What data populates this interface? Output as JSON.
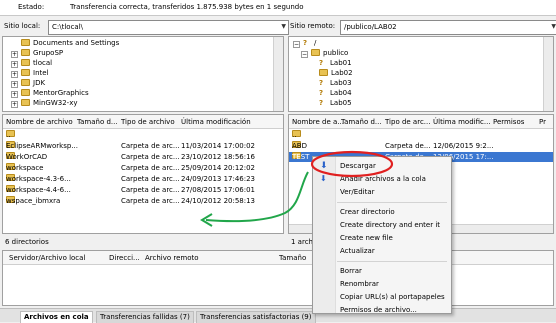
{
  "status": {
    "label": "Estado:",
    "text": "Transferencia correcta, transferidos 1.875.938 bytes en 1 segundo"
  },
  "local": {
    "path_label": "Sitio local:",
    "path": "C:\\tlocal\\",
    "tree": [
      {
        "label": "Documents and Settings"
      },
      {
        "label": "GrupoSP"
      },
      {
        "label": "tlocal"
      },
      {
        "label": "Intel"
      },
      {
        "label": "JDK"
      },
      {
        "label": "MentorGraphics"
      },
      {
        "label": "MinGW32-xy"
      }
    ],
    "columns": [
      "Nombre de archivo",
      "Tamaño d...",
      "Tipo de archivo",
      "Última modificación"
    ],
    "rows": [
      {
        "name": "..",
        "type": "",
        "date": ""
      },
      {
        "name": "EclipseARMworksp...",
        "type": "Carpeta de arc...",
        "date": "11/03/2014 17:00:02"
      },
      {
        "name": "WorkOrCAD",
        "type": "Carpeta de arc...",
        "date": "23/10/2012 18:56:16"
      },
      {
        "name": "workspace",
        "type": "Carpeta de arc...",
        "date": "25/09/2014 20:12:02"
      },
      {
        "name": "workspace-4.3-6...",
        "type": "Carpeta de arc...",
        "date": "24/09/2013 17:46:23"
      },
      {
        "name": "workspace-4.4-6...",
        "type": "Carpeta de arc...",
        "date": "27/08/2015 17:06:01"
      },
      {
        "name": "wspace_ibmxra",
        "type": "Carpeta de arc...",
        "date": "24/10/2012 20:58:13"
      }
    ],
    "summary": "6 directorios"
  },
  "remote": {
    "path_label": "Sitio remoto:",
    "path": "/publico/LAB02",
    "tree": [
      {
        "label": "/",
        "q": true
      },
      {
        "label": "publico",
        "q": false
      },
      {
        "label": "Lab01",
        "q": true
      },
      {
        "label": "Lab02",
        "q": false
      },
      {
        "label": "Lab03",
        "q": true
      },
      {
        "label": "Lab04",
        "q": true
      },
      {
        "label": "Lab05",
        "q": true
      }
    ],
    "columns": [
      "Nombre de a...",
      "Tamaño d...",
      "Tipo de arc...",
      "Última modific...",
      "Permisos",
      "Pr"
    ],
    "rows": [
      {
        "name": "..",
        "type": "",
        "date": ""
      },
      {
        "name": "ABD",
        "type": "Carpeta de...",
        "date": "12/06/2015 9:2..."
      },
      {
        "name": "TEST",
        "type": "Carpeta de...",
        "date": "12/06/2015 17:..."
      }
    ],
    "summary": "1 archivo"
  },
  "queue": {
    "columns": [
      "Servidor/Archivo local",
      "Direcci...",
      "Archivo remoto",
      "Tamaño"
    ]
  },
  "tabs": [
    "Archivos en cola",
    "Transferencias fallidas (7)",
    "Transferencias satisfactorias (9)"
  ],
  "context_menu": [
    {
      "label": "Descargar",
      "icon": "download-icon"
    },
    {
      "label": "Añadir archivos a la cola",
      "icon": "add-to-queue-icon"
    },
    {
      "label": "Ver/Editar"
    },
    {
      "sep": true
    },
    {
      "label": "Crear directorio"
    },
    {
      "label": "Create directory and enter it"
    },
    {
      "label": "Create new file"
    },
    {
      "label": "Actualizar"
    },
    {
      "sep": true
    },
    {
      "label": "Borrar"
    },
    {
      "label": "Renombrar"
    },
    {
      "label": "Copiar URL(s) al portapapeles"
    },
    {
      "label": "Permisos de archivo..."
    }
  ],
  "colors": {
    "highlight_circle": "#e02020",
    "arrow": "#21a64a",
    "selection": "#3b77d1"
  }
}
